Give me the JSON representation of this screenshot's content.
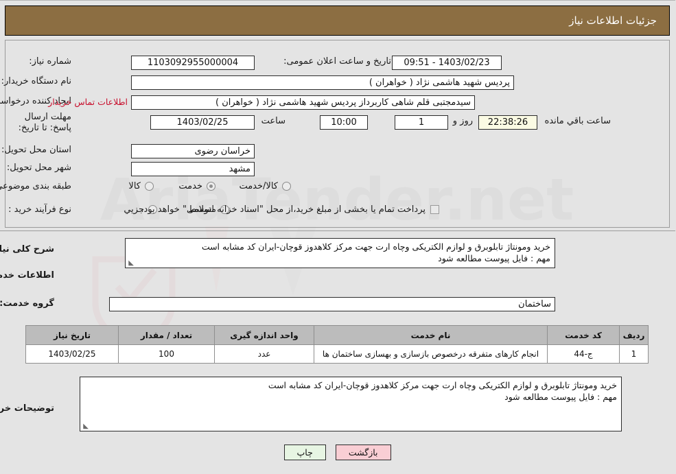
{
  "header": {
    "title": "جزئیات اطلاعات نیاز"
  },
  "form": {
    "need_number_label": "شماره نیاز:",
    "need_number_value": "1103092955000004",
    "announce_datetime_label": "تاریخ و ساعت اعلان عمومی:",
    "announce_datetime_value": "1403/02/23 - 09:51",
    "buyer_org_label": "نام دستگاه خریدار:",
    "buyer_org_value": "پردیس شهید هاشمی نژاد ( خواهران )",
    "creator_label": "ایجاد کننده درخواست:",
    "creator_value": "سیدمجتبی قلم شاهی کاربرداز پردیس شهید هاشمی نژاد ( خواهران )",
    "contact_link": "اطلاعات تماس خریدار",
    "deadline_label": "مهلت ارسال پاسخ: تا تاریخ:",
    "deadline_date": "1403/02/25",
    "hour_label": "ساعت",
    "deadline_time": "10:00",
    "days_value": "1",
    "days_label": "روز و",
    "countdown_value": "22:38:26",
    "remaining_label": "ساعت باقي مانده",
    "province_label": "استان محل تحویل:",
    "province_value": "خراسان رضوی",
    "city_label": "شهر محل تحویل:",
    "city_value": "مشهد",
    "category_label": "طبقه بندی موضوعی:",
    "category_options": [
      "کالا",
      "خدمت",
      "کالا/خدمت"
    ],
    "category_selected": "خدمت",
    "process_label": "نوع فرآیند خرید :",
    "process_options": [
      "جزیي",
      "متوسط"
    ],
    "process_selected": "",
    "treasury_checkbox_label": "پرداخت تمام یا بخشی از مبلغ خرید،از محل \"اسناد خزانه اسلامی\" خواهد بود.",
    "treasury_checked": false
  },
  "description": {
    "label": "شرح کلی نیاز:",
    "line1": "خرید ومونتاژ تابلوبرق و لوازم الکتریکی وچاه ارت جهت مرکز کلاهدوز قوچان-ایران کد مشابه است",
    "line2": "مهم : فایل پیوست مطالعه شود"
  },
  "services": {
    "section_title": "اطلاعات خدمات مورد نیاز",
    "group_label": "گروه خدمت:",
    "group_value": "ساختمان",
    "columns": [
      "ردیف",
      "کد خدمت",
      "نام خدمت",
      "واحد اندازه گیری",
      "تعداد / مقدار",
      "تاریخ نیاز"
    ],
    "rows": [
      {
        "radif": "1",
        "code": "ج-44",
        "name": "انجام کارهای متفرقه درخصوص بازسازی و بهسازی ساختمان ها",
        "unit": "عدد",
        "qty": "100",
        "date": "1403/02/25"
      }
    ]
  },
  "buyer_notes": {
    "label": "توضیحات خریدار:",
    "line1": "خرید ومونتاژ تابلوبرق و لوازم الکتریکی وچاه ارت جهت مرکز کلاهدوز قوچان-ایران کد مشابه است",
    "line2": "مهم : فایل پیوست مطالعه شود"
  },
  "footer": {
    "print_label": "چاپ",
    "back_label": "بازگشت"
  },
  "watermark": {
    "text": "AriaTender.net"
  },
  "colors": {
    "header_bg": "#8c6e42",
    "link_red": "#c8102e",
    "table_header_bg": "#bcbcbc",
    "print_btn_bg": "#e7f5e3",
    "back_btn_bg": "#f9ced4",
    "countdown_bg": "#fbfbe4"
  }
}
